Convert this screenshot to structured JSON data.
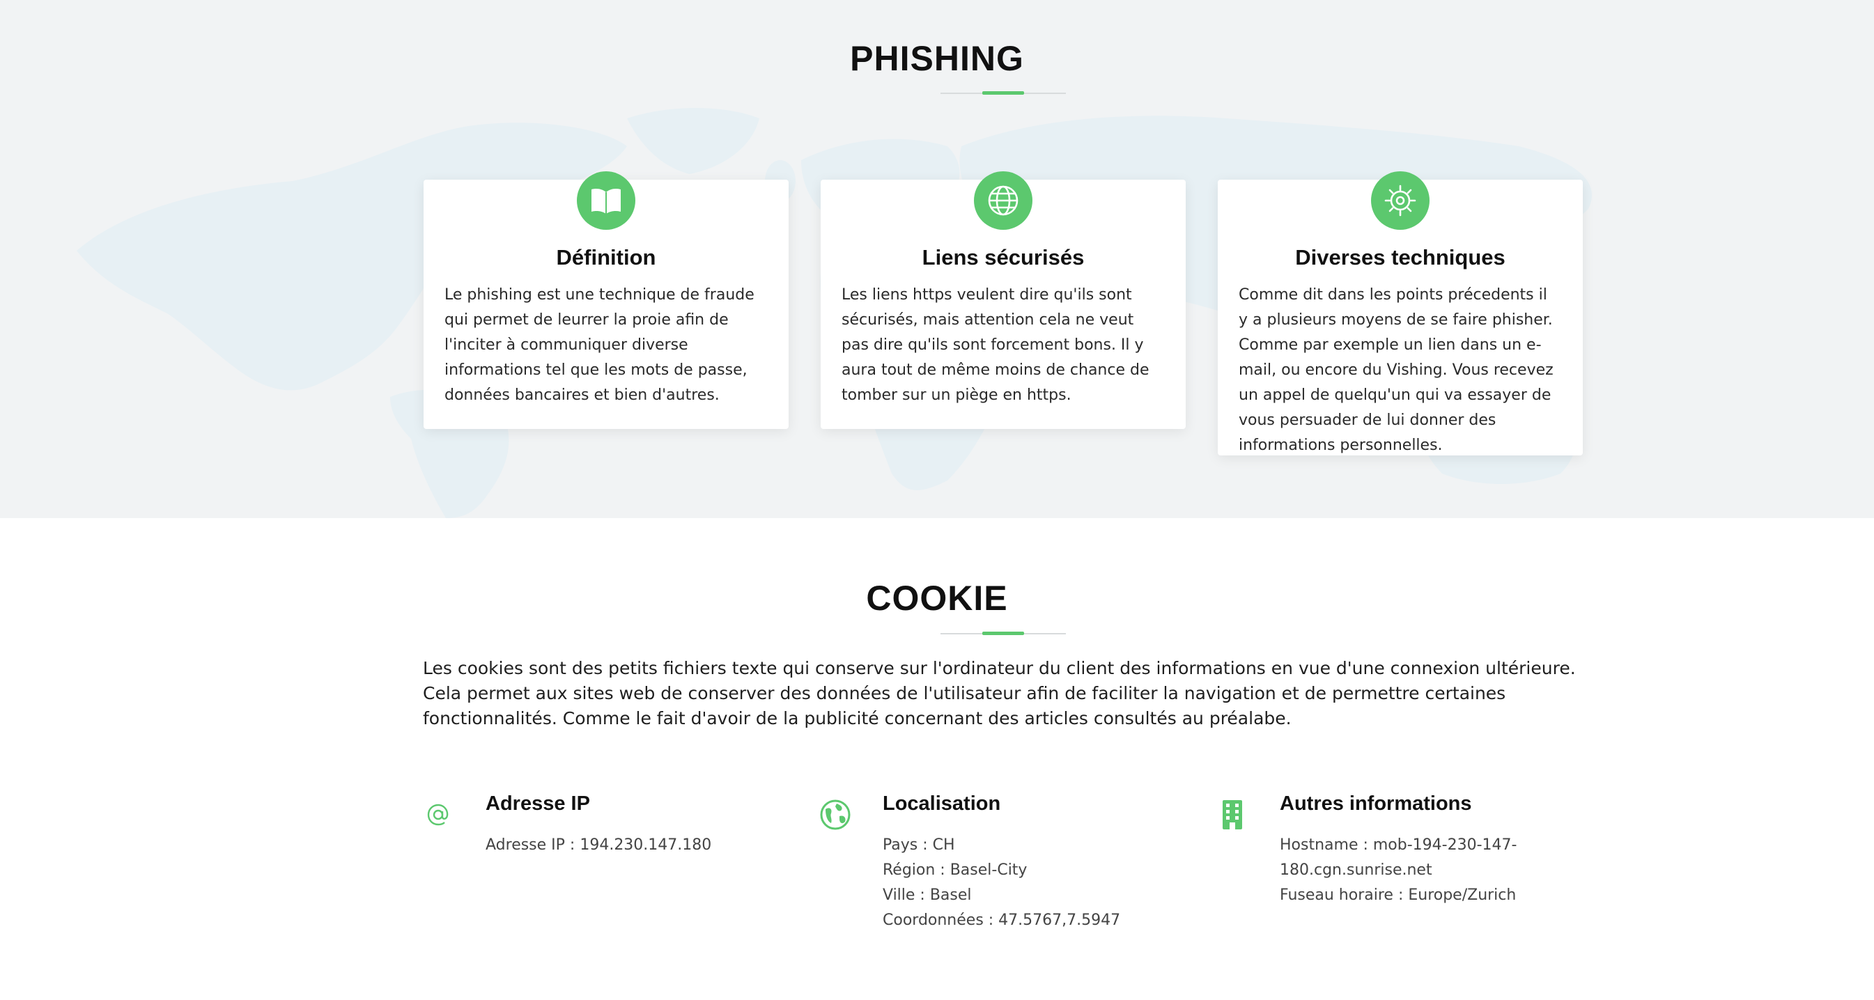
{
  "colors": {
    "accent": "#5cc86e",
    "phishing_background": "#f1f3f4",
    "map_tint": "#e6f0f4",
    "title_text": "#111111"
  },
  "phishing": {
    "title": "PHISHING",
    "cards": [
      {
        "icon": "open-book-icon",
        "title": "Définition",
        "text": "Le phishing est une technique de fraude qui permet de leurrer la proie afin de l'inciter à communiquer diverse informations tel que les mots de passe, données bancaires et bien d'autres."
      },
      {
        "icon": "globe-icon",
        "title": "Liens sécurisés",
        "text": "Les liens https veulent dire qu'ils sont sécurisés, mais attention cela ne veut pas dire qu'ils sont forcement bons. Il y aura tout de même moins de chance de tomber sur un piège en https."
      },
      {
        "icon": "gear-icon",
        "title": "Diverses techniques",
        "text": "Comme dit dans les points précedents il y a plusieurs moyens de se faire phisher. Comme par exemple un lien dans un e-mail, ou encore du Vishing. Vous recevez un appel de quelqu'un qui va essayer de vous persuader de lui donner des informations personnelles."
      }
    ]
  },
  "cookie": {
    "title": "COOKIE",
    "intro": "Les cookies sont des petits fichiers texte qui conserve sur l'ordinateur du client des informations en vue d'une connexion ultérieure. Cela permet aux sites web de conserver des données de l'utilisateur afin de faciliter la navigation et de permettre certaines fonctionnalités. Comme le fait d'avoir de la publicité concernant des articles consultés au préalabe.",
    "blocks": [
      {
        "icon": "at-sign-icon",
        "title": "Adresse IP",
        "lines": [
          "Adresse IP : 194.230.147.180"
        ]
      },
      {
        "icon": "earth-icon",
        "title": "Localisation",
        "lines": [
          "Pays : CH",
          "Région : Basel-City",
          "Ville : Basel",
          "Coordonnées : 47.5767,7.5947"
        ]
      },
      {
        "icon": "building-icon",
        "title": "Autres informations",
        "lines": [
          "Hostname : mob-194-230-147-180.cgn.sunrise.net",
          "Fuseau horaire : Europe/Zurich"
        ]
      }
    ]
  }
}
